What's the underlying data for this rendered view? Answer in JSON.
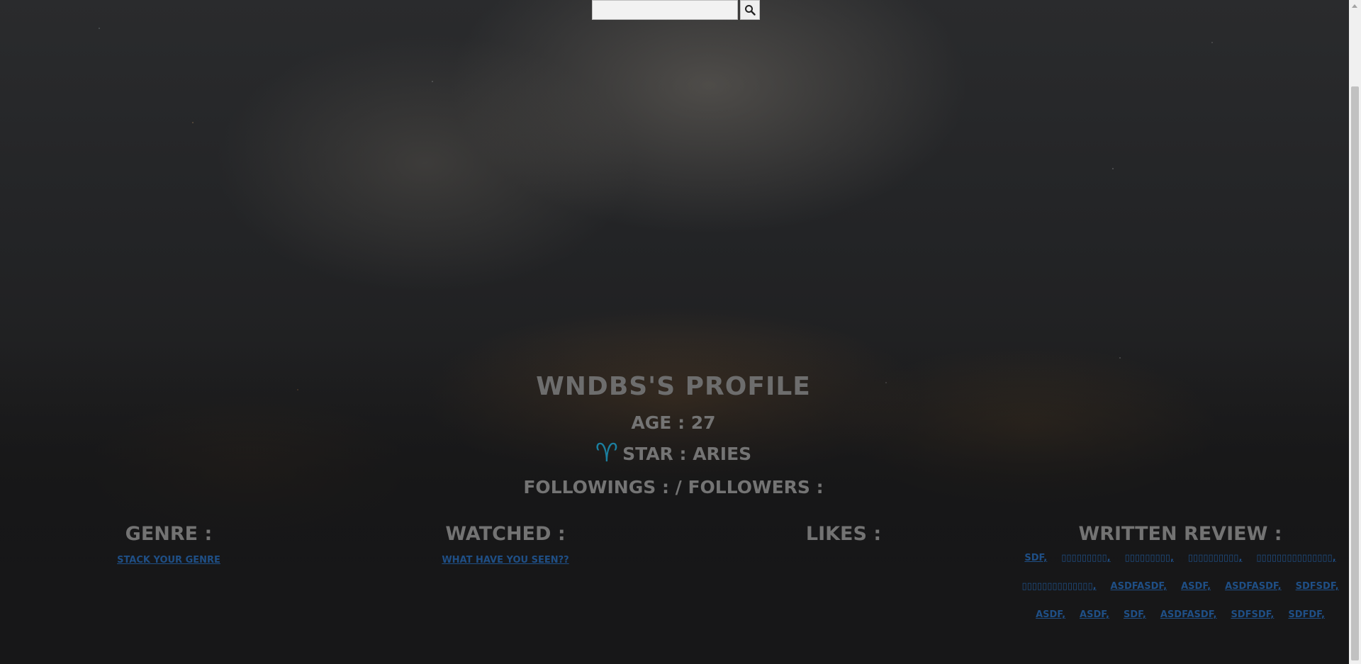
{
  "search": {
    "placeholder": "",
    "value": "",
    "icon": "search-icon"
  },
  "profile": {
    "title": "WNDBS'S PROFILE",
    "age": "AGE : 27",
    "star": "STAR : ARIES",
    "star_icon": "aries-icon",
    "follow": "FOLLOWINGS : / FOLLOWERS :"
  },
  "sections": {
    "genre": {
      "heading": "GENRE :",
      "link": "STACK YOUR GENRE"
    },
    "watched": {
      "heading": "WATCHED :",
      "link": "WHAT HAVE YOU SEEN??"
    },
    "likes": {
      "heading": "LIKES :"
    },
    "reviews": {
      "heading": "WRITTEN REVIEW :",
      "items": [
        "SDF,",
        "▯▯▯▯▯▯▯▯▯,",
        "▯▯▯▯▯▯▯▯▯,",
        "▯▯▯▯▯▯▯▯▯▯,",
        "▯▯▯▯▯▯▯▯▯▯▯▯▯▯▯,",
        "▯▯▯▯▯▯▯▯▯▯▯▯▯▯,",
        "ASDFASDF,",
        "ASDF,",
        "ASDFASDF,",
        "SDFSDF,",
        "ASDF,",
        "ASDF,",
        "SDF,",
        "ASDFASDF,",
        "SDFSDF,",
        "SDFDF,"
      ]
    }
  }
}
